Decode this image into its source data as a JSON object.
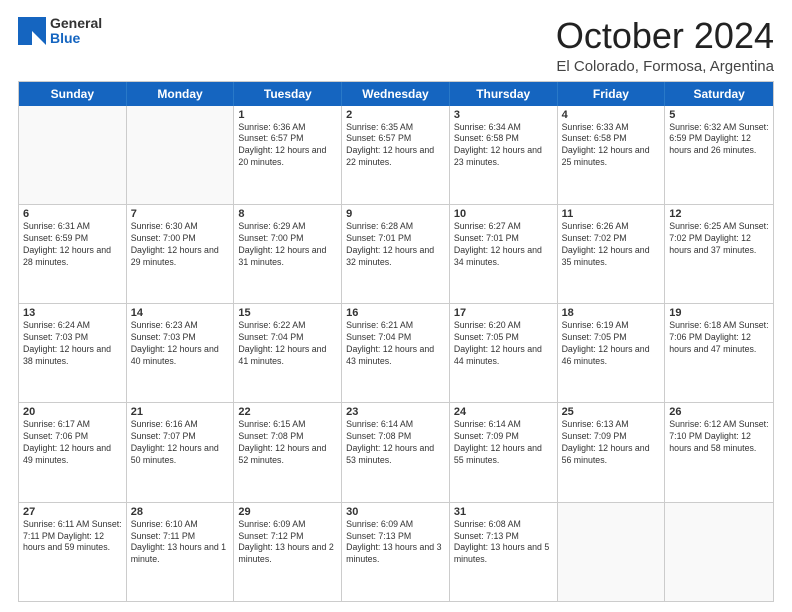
{
  "header": {
    "logo_general": "General",
    "logo_blue": "Blue",
    "month_title": "October 2024",
    "location": "El Colorado, Formosa, Argentina"
  },
  "days_of_week": [
    "Sunday",
    "Monday",
    "Tuesday",
    "Wednesday",
    "Thursday",
    "Friday",
    "Saturday"
  ],
  "weeks": [
    [
      {
        "day": "",
        "info": ""
      },
      {
        "day": "",
        "info": ""
      },
      {
        "day": "1",
        "info": "Sunrise: 6:36 AM\nSunset: 6:57 PM\nDaylight: 12 hours and 20 minutes."
      },
      {
        "day": "2",
        "info": "Sunrise: 6:35 AM\nSunset: 6:57 PM\nDaylight: 12 hours and 22 minutes."
      },
      {
        "day": "3",
        "info": "Sunrise: 6:34 AM\nSunset: 6:58 PM\nDaylight: 12 hours and 23 minutes."
      },
      {
        "day": "4",
        "info": "Sunrise: 6:33 AM\nSunset: 6:58 PM\nDaylight: 12 hours and 25 minutes."
      },
      {
        "day": "5",
        "info": "Sunrise: 6:32 AM\nSunset: 6:59 PM\nDaylight: 12 hours and 26 minutes."
      }
    ],
    [
      {
        "day": "6",
        "info": "Sunrise: 6:31 AM\nSunset: 6:59 PM\nDaylight: 12 hours and 28 minutes."
      },
      {
        "day": "7",
        "info": "Sunrise: 6:30 AM\nSunset: 7:00 PM\nDaylight: 12 hours and 29 minutes."
      },
      {
        "day": "8",
        "info": "Sunrise: 6:29 AM\nSunset: 7:00 PM\nDaylight: 12 hours and 31 minutes."
      },
      {
        "day": "9",
        "info": "Sunrise: 6:28 AM\nSunset: 7:01 PM\nDaylight: 12 hours and 32 minutes."
      },
      {
        "day": "10",
        "info": "Sunrise: 6:27 AM\nSunset: 7:01 PM\nDaylight: 12 hours and 34 minutes."
      },
      {
        "day": "11",
        "info": "Sunrise: 6:26 AM\nSunset: 7:02 PM\nDaylight: 12 hours and 35 minutes."
      },
      {
        "day": "12",
        "info": "Sunrise: 6:25 AM\nSunset: 7:02 PM\nDaylight: 12 hours and 37 minutes."
      }
    ],
    [
      {
        "day": "13",
        "info": "Sunrise: 6:24 AM\nSunset: 7:03 PM\nDaylight: 12 hours and 38 minutes."
      },
      {
        "day": "14",
        "info": "Sunrise: 6:23 AM\nSunset: 7:03 PM\nDaylight: 12 hours and 40 minutes."
      },
      {
        "day": "15",
        "info": "Sunrise: 6:22 AM\nSunset: 7:04 PM\nDaylight: 12 hours and 41 minutes."
      },
      {
        "day": "16",
        "info": "Sunrise: 6:21 AM\nSunset: 7:04 PM\nDaylight: 12 hours and 43 minutes."
      },
      {
        "day": "17",
        "info": "Sunrise: 6:20 AM\nSunset: 7:05 PM\nDaylight: 12 hours and 44 minutes."
      },
      {
        "day": "18",
        "info": "Sunrise: 6:19 AM\nSunset: 7:05 PM\nDaylight: 12 hours and 46 minutes."
      },
      {
        "day": "19",
        "info": "Sunrise: 6:18 AM\nSunset: 7:06 PM\nDaylight: 12 hours and 47 minutes."
      }
    ],
    [
      {
        "day": "20",
        "info": "Sunrise: 6:17 AM\nSunset: 7:06 PM\nDaylight: 12 hours and 49 minutes."
      },
      {
        "day": "21",
        "info": "Sunrise: 6:16 AM\nSunset: 7:07 PM\nDaylight: 12 hours and 50 minutes."
      },
      {
        "day": "22",
        "info": "Sunrise: 6:15 AM\nSunset: 7:08 PM\nDaylight: 12 hours and 52 minutes."
      },
      {
        "day": "23",
        "info": "Sunrise: 6:14 AM\nSunset: 7:08 PM\nDaylight: 12 hours and 53 minutes."
      },
      {
        "day": "24",
        "info": "Sunrise: 6:14 AM\nSunset: 7:09 PM\nDaylight: 12 hours and 55 minutes."
      },
      {
        "day": "25",
        "info": "Sunrise: 6:13 AM\nSunset: 7:09 PM\nDaylight: 12 hours and 56 minutes."
      },
      {
        "day": "26",
        "info": "Sunrise: 6:12 AM\nSunset: 7:10 PM\nDaylight: 12 hours and 58 minutes."
      }
    ],
    [
      {
        "day": "27",
        "info": "Sunrise: 6:11 AM\nSunset: 7:11 PM\nDaylight: 12 hours and 59 minutes."
      },
      {
        "day": "28",
        "info": "Sunrise: 6:10 AM\nSunset: 7:11 PM\nDaylight: 13 hours and 1 minute."
      },
      {
        "day": "29",
        "info": "Sunrise: 6:09 AM\nSunset: 7:12 PM\nDaylight: 13 hours and 2 minutes."
      },
      {
        "day": "30",
        "info": "Sunrise: 6:09 AM\nSunset: 7:13 PM\nDaylight: 13 hours and 3 minutes."
      },
      {
        "day": "31",
        "info": "Sunrise: 6:08 AM\nSunset: 7:13 PM\nDaylight: 13 hours and 5 minutes."
      },
      {
        "day": "",
        "info": ""
      },
      {
        "day": "",
        "info": ""
      }
    ]
  ]
}
